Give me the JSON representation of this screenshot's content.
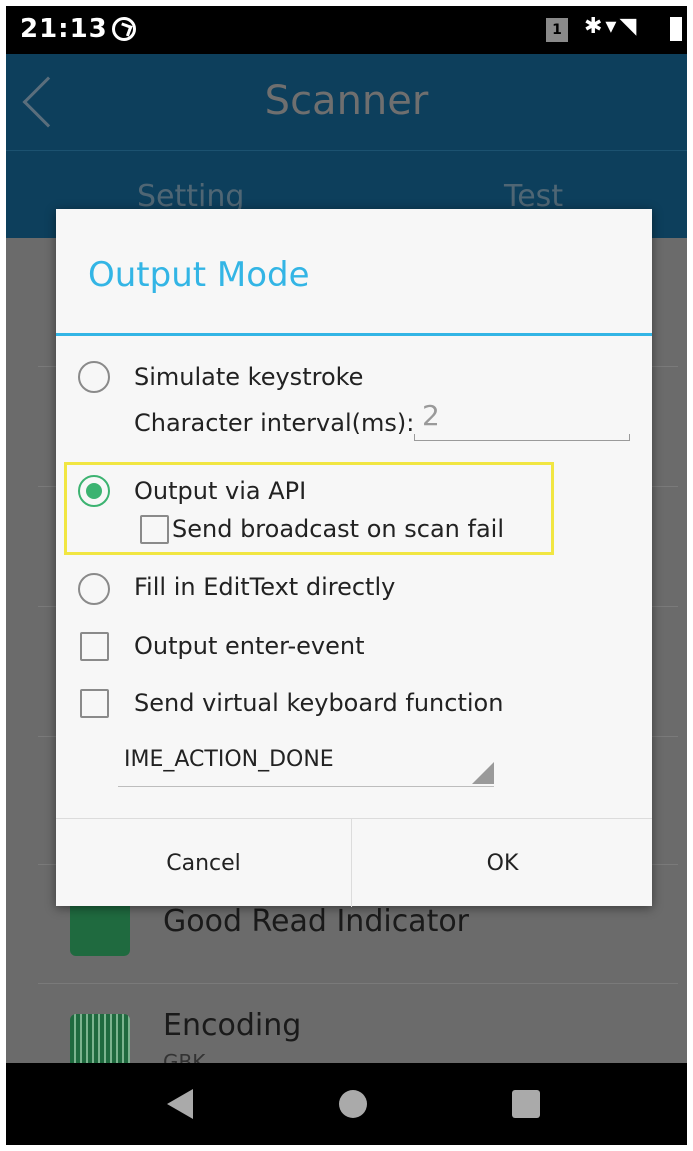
{
  "status_bar": {
    "time": "21:13",
    "sim_label": "1"
  },
  "app_bar": {
    "title": "Scanner"
  },
  "tabs": [
    {
      "label": "Setting"
    },
    {
      "label": "Test"
    }
  ],
  "background_list": [
    {
      "title": "Good Read Indicator",
      "subtitle": ""
    },
    {
      "title": "Encoding",
      "subtitle": "GBK"
    }
  ],
  "dialog": {
    "title": "Output Mode",
    "options": [
      {
        "type": "radio",
        "label": "Simulate keystroke",
        "checked": false
      },
      {
        "type": "radio",
        "label": "Output via API",
        "checked": true
      },
      {
        "type": "radio",
        "label": "Fill in EditText directly",
        "checked": false
      },
      {
        "type": "checkbox",
        "label": "Output enter-event",
        "checked": false
      },
      {
        "type": "checkbox",
        "label": "Send virtual keyboard function",
        "checked": false
      }
    ],
    "interval": {
      "label": "Character interval(ms):",
      "value": "2"
    },
    "broadcast": {
      "label": "Send broadcast on scan fail",
      "checked": false
    },
    "ime_action": {
      "selected": "IME_ACTION_DONE"
    },
    "buttons": {
      "cancel": "Cancel",
      "ok": "OK"
    },
    "highlight_color": "#f1e642",
    "accent_color": "#33b5e5"
  }
}
